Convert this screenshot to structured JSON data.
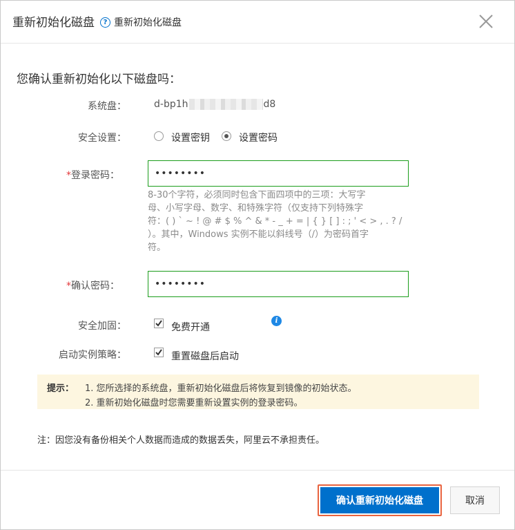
{
  "dialog": {
    "title": "重新初始化磁盘",
    "help_text": "重新初始化磁盘",
    "question": "您确认重新初始化以下磁盘吗："
  },
  "form": {
    "system_disk": {
      "label": "系统盘：",
      "prefix": "d-bp1h",
      "suffix": "d8"
    },
    "security": {
      "label": "安全设置：",
      "options": [
        {
          "label": "设置密钥",
          "checked": false
        },
        {
          "label": "设置密码",
          "checked": true
        }
      ]
    },
    "password": {
      "required_mark": "*",
      "label": "登录密码：",
      "value": "••••••••"
    },
    "password_hint": [
      "8-30个字符，必须同时包含下面四项中的三项：大写字",
      "母、小写字母、数字、和特殊字符（仅支持下列特殊字",
      "符：( ) ` ~ ! @ # $ % ^ & * - _ + = | { } [ ] : ; ' < > , . ? /",
      "）。其中，Windows 实例不能以斜线号（/）为密码首字",
      "符。"
    ],
    "confirm_password": {
      "required_mark": "*",
      "label": "确认密码：",
      "value": "••••••••"
    },
    "security_hardening": {
      "label": "安全加固：",
      "option": "免费开通",
      "checked": true
    },
    "start_policy": {
      "label": "启动实例策略：",
      "option": "重置磁盘后启动",
      "checked": true
    }
  },
  "tips": {
    "label": "提示：",
    "lines": [
      "1. 您所选择的系统盘，重新初始化磁盘后将恢复到镜像的初始状态。",
      "2. 重新初始化磁盘时您需要重新设置实例的登录密码。"
    ]
  },
  "note": "注：因您没有备份相关个人数据而造成的数据丢失，阿里云不承担责任。",
  "buttons": {
    "confirm": "确认重新初始化磁盘",
    "cancel": "取消"
  },
  "colors": {
    "primary": "#0070cc",
    "highlight_outline": "#e8633f",
    "input_border": "#1a9c1a",
    "tip_background": "#fdf6e0",
    "required": "#e4393c"
  },
  "icons": {
    "help": "question-circle-icon",
    "close": "close-icon",
    "info": "info-icon"
  }
}
